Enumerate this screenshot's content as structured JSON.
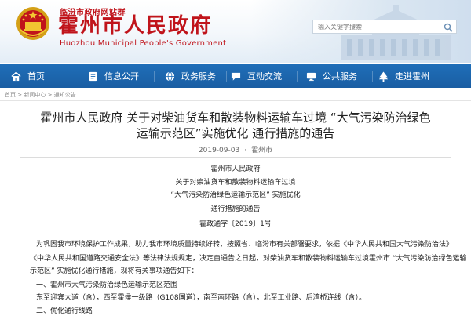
{
  "header": {
    "subtitle": "临汾市政府网站群",
    "title": "霍州市人民政府",
    "title_en": "Huozhou Municipal People's Government",
    "search_placeholder": "输入关键字搜索",
    "brand_color": "#c0141b"
  },
  "nav": {
    "items": [
      {
        "label": "首页",
        "icon": "home-icon"
      },
      {
        "label": "信息公开",
        "icon": "document-icon"
      },
      {
        "label": "政务服务",
        "icon": "globe-icon"
      },
      {
        "label": "互动交流",
        "icon": "chat-icon"
      },
      {
        "label": "公共服务",
        "icon": "monitor-icon"
      },
      {
        "label": "走进霍州",
        "icon": "tree-icon"
      }
    ],
    "bg_color": "#1f6eb8"
  },
  "breadcrumb": [
    "首页",
    "新闻中心",
    "通知公告"
  ],
  "article": {
    "title_line1": "霍州市人民政府 关于对柴油货车和散装物料运输车过境 “大气污染防治绿色",
    "title_line2": "运输示范区”实施优化 通行措施的通告",
    "date": "2019-09-03",
    "source": "霍州市",
    "heading_lines": [
      "霍州市人民政府",
      "关于对柴油货车和散装物料运输车过境",
      "“大气污染防治绿色运输示范区” 实施优化",
      "通行措施的通告",
      "霍政通字〔2019〕1号"
    ],
    "body_lines": [
      "为巩固我市环境保护工作成果，助力我市环境质量持续好转，按照省、临汾市有关部署要求，依据《中华人民共和国大气污染防治法》",
      "《中华人民共和国道路交通安全法》等法律法规规定，决定自通告之日起，对柴油货车和散装物料运输车过境霍州市 “大气污染防治绿色运输",
      "示范区” 实施优化通行措施，现将有关事项通告如下：",
      "一、霍州市大气污染防治绿色运输示范区范围",
      "东至迎宾大道（含），西至霍侯一级路（G108国道），南至南环路（含），北至工业路、后湾桥连线（含）。",
      "二、优化通行线路"
    ]
  }
}
